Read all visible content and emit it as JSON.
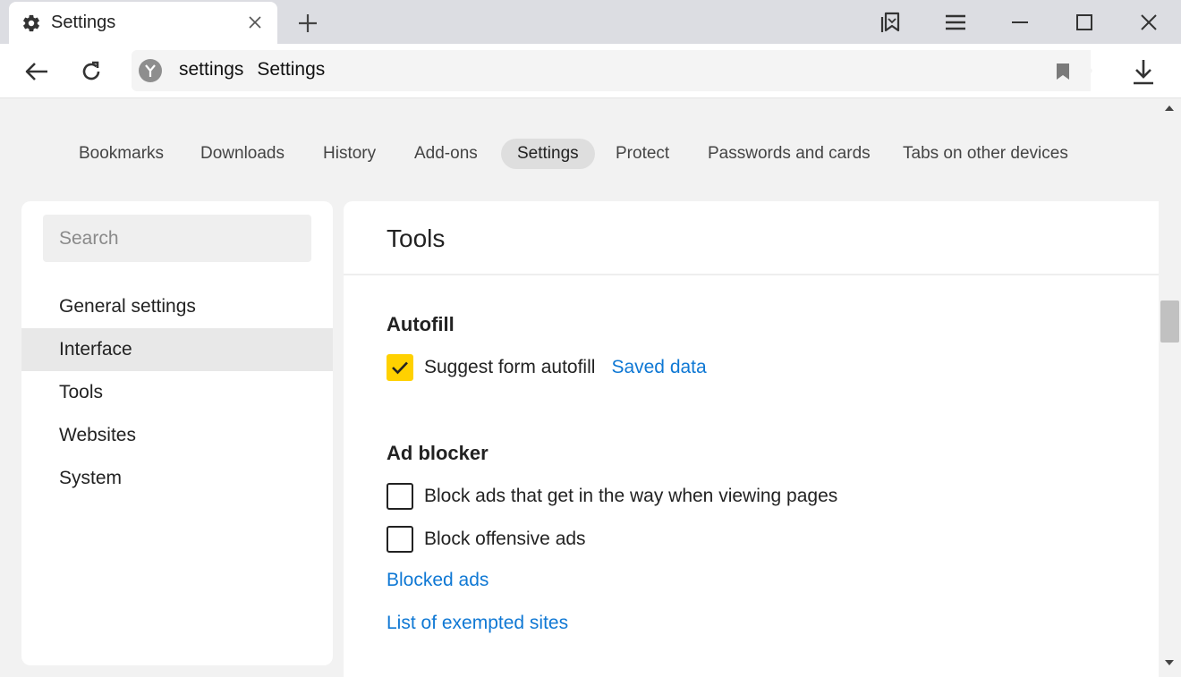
{
  "tab": {
    "title": "Settings"
  },
  "address": {
    "domain": "settings",
    "title": "Settings"
  },
  "page_nav": [
    {
      "label": "Bookmarks",
      "active": false
    },
    {
      "label": "Downloads",
      "active": false
    },
    {
      "label": "History",
      "active": false
    },
    {
      "label": "Add-ons",
      "active": false
    },
    {
      "label": "Settings",
      "active": true
    },
    {
      "label": "Protect",
      "active": false
    },
    {
      "label": "Passwords and cards",
      "active": false
    },
    {
      "label": "Tabs on other devices",
      "active": false
    }
  ],
  "sidebar": {
    "search_placeholder": "Search",
    "items": [
      {
        "label": "General settings",
        "active": false
      },
      {
        "label": "Interface",
        "active": true
      },
      {
        "label": "Tools",
        "active": false
      },
      {
        "label": "Websites",
        "active": false
      },
      {
        "label": "System",
        "active": false
      }
    ]
  },
  "main": {
    "title": "Tools",
    "autofill": {
      "heading": "Autofill",
      "suggest_label": "Suggest form autofill",
      "suggest_checked": true,
      "saved_data_link": "Saved data"
    },
    "ad_blocker": {
      "heading": "Ad blocker",
      "option1_label": "Block ads that get in the way when viewing pages",
      "option1_checked": false,
      "option2_label": "Block offensive ads",
      "option2_checked": false,
      "blocked_ads_link": "Blocked ads",
      "exempted_link": "List of exempted sites"
    }
  },
  "colors": {
    "accent_yellow": "#ffd100",
    "link_blue": "#0f78d4"
  }
}
